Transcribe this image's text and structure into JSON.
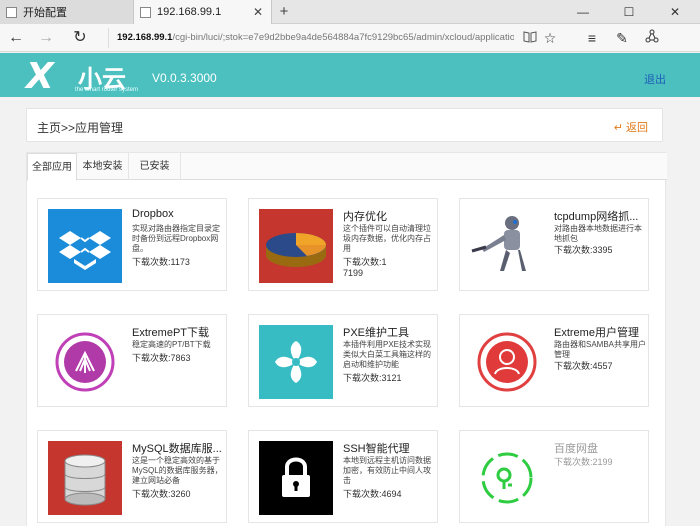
{
  "browser": {
    "tabs": [
      {
        "title": "开始配置",
        "active": false
      },
      {
        "title": "192.168.99.1",
        "active": true
      }
    ],
    "new_tab_glyph": "+",
    "window_controls": [
      "—",
      "☐",
      "✕"
    ],
    "url_host": "192.168.99.1",
    "url_path": "/cgi-bin/luci/;stok=e7e9d2bbe9a4de564884a7fc9129bc65/admin/xcloud/application",
    "nav_icons": [
      "back-arrow-icon",
      "forward-arrow-icon",
      "refresh-icon"
    ],
    "toolbar_icons": [
      "reading-view-icon",
      "favorite-star-icon",
      "hub-icon",
      "note-icon",
      "share-icon"
    ]
  },
  "header": {
    "logo_x": "X",
    "logo_cn": "小云",
    "logo_sub": "the smart router system",
    "version": "V0.0.3.3000",
    "logout": "退出",
    "bg_color": "#4cbfbf"
  },
  "breadcrumb": {
    "path": "主页>>应用管理",
    "back_label": "返回"
  },
  "tabs": [
    {
      "label": "全部应用",
      "active": true
    },
    {
      "label": "本地安装",
      "active": false
    },
    {
      "label": "已安装",
      "active": false
    }
  ],
  "apps": [
    {
      "name": "Dropbox",
      "desc": "实现对路由器指定目录定时备份到远程Dropbox网盘。",
      "count": "下载次数:1173",
      "icon": "dropbox-icon"
    },
    {
      "name": "内存优化",
      "desc": "这个插件可以自动清理垃圾内存数据，优化内存占用",
      "count": "下载次数:17199",
      "icon": "pie-chart-icon"
    },
    {
      "name": "tcpdump网络抓...",
      "desc": "对路由器本地数据进行本地抓包",
      "count": "下载次数:3395",
      "icon": "robot-icon"
    },
    {
      "name": "ExtremePT下载",
      "desc": "稳定高速的PT/BT下载",
      "count": "下载次数:7863",
      "icon": "torrent-icon"
    },
    {
      "name": "PXE维护工具",
      "desc": "本插件利用PXE技术实现类似大白菜工具箱这样的启动和维护功能",
      "count": "下载次数:3121",
      "icon": "pinwheel-icon"
    },
    {
      "name": "Extreme用户管理",
      "desc": "路由器和SAMBA共享用户管理",
      "count": "下载次数:4557",
      "icon": "user-icon"
    },
    {
      "name": "MySQL数据库服...",
      "desc": "这是一个稳定高效的基于MySQL的数据库服务器，建立网站必备",
      "count": "下载次数:3260",
      "icon": "database-icon"
    },
    {
      "name": "SSH智能代理",
      "desc": "本地到远程主机访问数据加密，有效防止中间人攻击",
      "count": "下载次数:4694",
      "icon": "lock-icon"
    },
    {
      "name": "百度网盘",
      "desc": "",
      "count": "下载次数:2199",
      "icon": "baidu-pan-icon"
    }
  ]
}
